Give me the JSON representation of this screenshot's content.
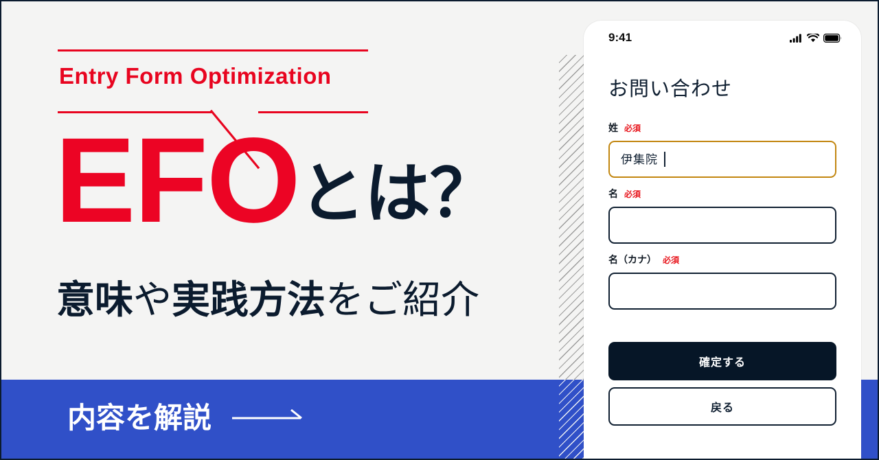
{
  "colors": {
    "red": "#ec0424",
    "navy": "#0b1b2e",
    "blue": "#3050c8",
    "gold": "#c2860f",
    "light_bg": "#f4f4f3",
    "required_red": "#e8181f"
  },
  "poster": {
    "eyebrow": "Entry Form Optimization",
    "title_accent": "EFO",
    "title_rest": "とは？",
    "subtitle_parts": [
      {
        "text": "意味",
        "weight": "bold"
      },
      {
        "text": "や",
        "weight": "normal"
      },
      {
        "text": "実践方法",
        "weight": "bold"
      },
      {
        "text": "をご紹介",
        "weight": "normal"
      }
    ],
    "subtitle_full": "意味や実践方法をご紹介",
    "banner_text": "内容を解説",
    "banner_arrow": "arrow-right-icon"
  },
  "phone": {
    "status_bar": {
      "time": "9:41",
      "icons": [
        "cellular-signal-icon",
        "wifi-icon",
        "battery-icon"
      ]
    },
    "screen_title": "お問い合わせ",
    "fields": [
      {
        "label": "姓",
        "required_badge": "必須",
        "value": "伊集院",
        "placeholder": "",
        "focused": true
      },
      {
        "label": "名",
        "required_badge": "必須",
        "value": "",
        "placeholder": "",
        "focused": false
      },
      {
        "label": "名（カナ）",
        "required_badge": "必須",
        "value": "",
        "placeholder": "",
        "focused": false
      }
    ],
    "buttons": {
      "primary": "確定する",
      "secondary": "戻る"
    }
  }
}
